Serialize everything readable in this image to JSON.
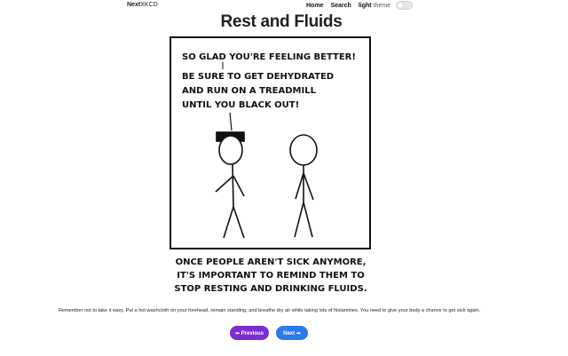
{
  "header": {
    "brand_bold": "Next",
    "brand_rest": "XKCD",
    "nav": {
      "home": "Home",
      "search": "Search",
      "theme_strong": "light",
      "theme_rest": "theme"
    }
  },
  "comic": {
    "title": "Rest and Fluids",
    "speech_lines": [
      "SO GLAD YOU'RE FEELING BETTER!",
      "BE SURE TO GET DEHYDRATED",
      "AND RUN ON A TREADMILL",
      "UNTIL YOU BLACK OUT!"
    ],
    "caption_lines": [
      "ONCE PEOPLE AREN'T SICK ANYMORE,",
      "IT'S IMPORTANT TO REMIND THEM TO",
      "STOP RESTING AND DRINKING FLUIDS."
    ],
    "alt_text": "Remember not to take it easy. Put a hot washcloth on your forehead, remain standing, and breathe dry air while taking lots of histamines. You need to give your body a chance to get sick again."
  },
  "pagination": {
    "previous": "⬅ Previous",
    "next": "Next ➡"
  },
  "colors": {
    "previous_button": "#7a2dd0",
    "next_button": "#2d79ee"
  }
}
